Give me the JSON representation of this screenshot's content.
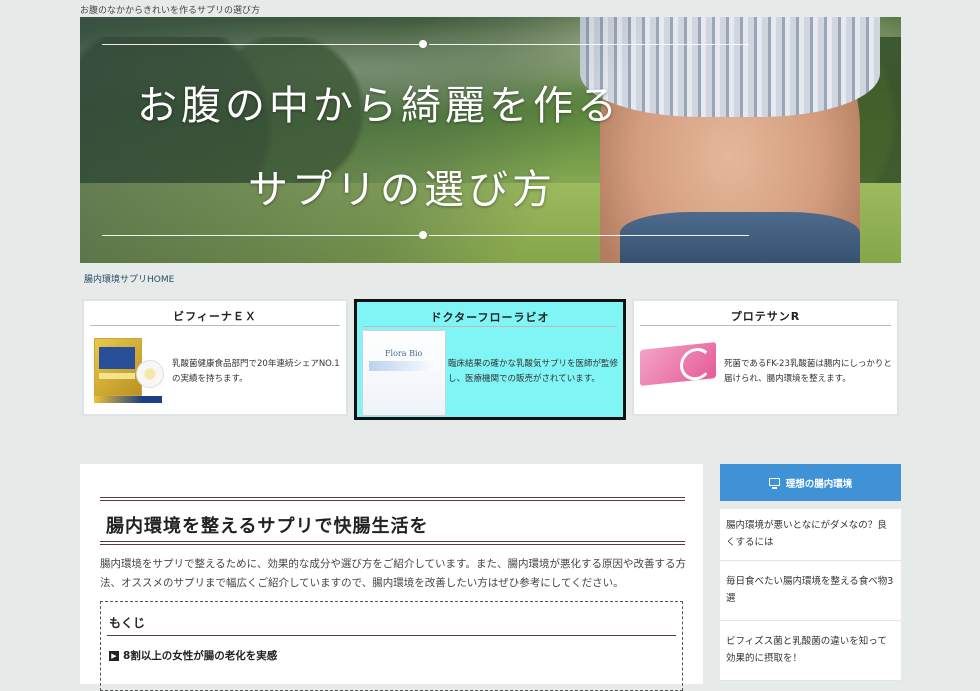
{
  "site": {
    "tagline": "お腹のなかからきれいを作るサプリの選び方"
  },
  "hero": {
    "line1": "お腹の中から綺麗を作る",
    "line2": "サプリの選び方"
  },
  "breadcrumb": {
    "home": "腸内環境サプリHOME"
  },
  "products": [
    {
      "title": "ビフィーナＥＸ",
      "description": "乳酸菌健康食品部門で20年連続シェアNO.1の実績を持ちます。",
      "image_icon": "product-box-image",
      "active": false
    },
    {
      "title": "ドクターフローラビオ",
      "description": "臨床結果の確かな乳酸気サプリを医師が監修し、医療機関での販売がされています。",
      "image_icon": "product-box-image",
      "image_text": "Flora Bio",
      "active": true
    },
    {
      "title": "プロテサンR",
      "description": "死菌であるFK-23乳酸菌は腸内にしっかりと届けられ、腸内環境を整えます。",
      "image_icon": "product-box-image",
      "active": false
    }
  ],
  "main": {
    "title": "腸内環境を整えるサプリで快腸生活を",
    "intro": "腸内環境をサプリで整えるために、効果的な成分や選び方をご紹介しています。また、腸内環境が悪化する原因や改善する方法、オススメのサプリまで幅広くご紹介していますので、腸内環境を改善したい方はぜひ参考にしてください。",
    "toc": {
      "title": "もくじ",
      "items": [
        "8割以上の女性が腸の老化を実感"
      ]
    }
  },
  "sidebar": {
    "heading": "理想の腸内環境",
    "items": [
      "腸内環境が悪いとなにがダメなの？良くするには",
      "毎日食べたい腸内環境を整える食べ物3選",
      "ビフィズス菌と乳酸菌の違いを知って効果的に摂取を！"
    ]
  },
  "colors": {
    "background": "#e6ebea",
    "active_card": "#7ff5f5",
    "sidebar_header": "#3f92d6",
    "heading_rule": "#5a3b3b"
  }
}
